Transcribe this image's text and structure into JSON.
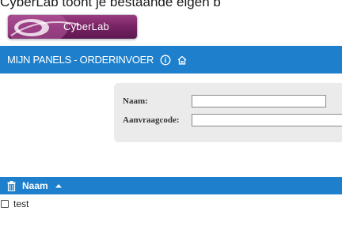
{
  "intro_text": "CyberLab toont je bestaande eigen b",
  "logo": {
    "text": "CyberLab"
  },
  "navbar": {
    "title": "MIJN PANELS - ORDERINVOER",
    "icons": [
      "info-circle-icon",
      "home-icon"
    ]
  },
  "search_form": {
    "name_label": "Naam:",
    "name_value": "",
    "code_label": "Aanvraagcode:",
    "code_value": ""
  },
  "table": {
    "header": {
      "column_label": "Naam",
      "sort": "ascending"
    },
    "rows": [
      {
        "label": "test",
        "checked": false
      }
    ]
  },
  "colors": {
    "accent": "#1e80cc",
    "form_background": "#ebebeb",
    "logo": "#7a2566"
  }
}
